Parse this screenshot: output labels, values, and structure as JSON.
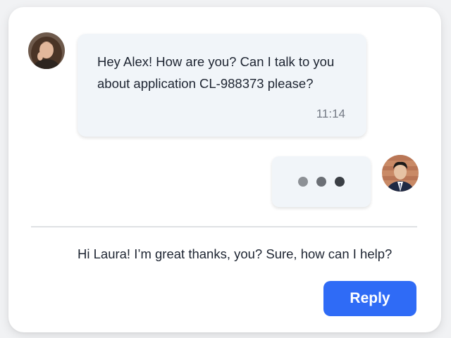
{
  "colors": {
    "accent": "#2f6bf6",
    "bubble_background": "#f1f5f9",
    "card_background": "#ffffff",
    "text": "#1d2431",
    "muted_text": "#757b86"
  },
  "conversation": {
    "incoming": {
      "sender_avatar": "laura-avatar",
      "text": "Hey Alex! How are you? Can I talk to you about application CL-988373 please?",
      "time": "11:14"
    },
    "typing_indicator": {
      "sender_avatar": "alex-avatar",
      "dot_colors": [
        "#8d9196",
        "#6b6f75",
        "#3b3f45"
      ]
    }
  },
  "composer": {
    "text": "Hi Laura! I’m great thanks, you? Sure, how can I help?",
    "reply_label": "Reply"
  }
}
